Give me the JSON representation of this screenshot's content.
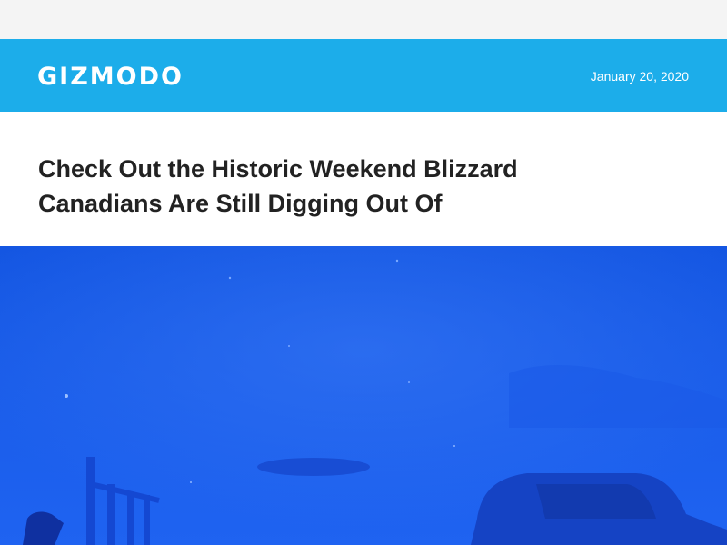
{
  "header": {
    "logo_text": "GIZMODO",
    "date": "January 20, 2020",
    "background_color": "#1cadea"
  },
  "article": {
    "headline": "Check Out the Historic Weekend Blizzard Canadians Are Still Digging Out Of"
  },
  "hero_image": {
    "tint_color": "#1d62f0"
  }
}
